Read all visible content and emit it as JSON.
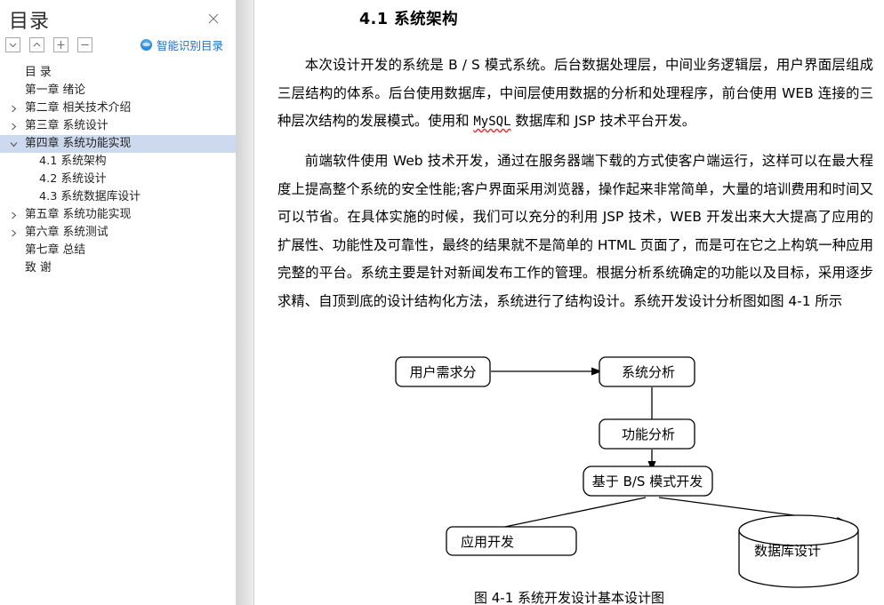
{
  "toc": {
    "title": "目录",
    "close_icon": "close-icon",
    "toolbar": [
      {
        "name": "collapse-all-button",
        "icon": "chevron-down-icon"
      },
      {
        "name": "expand-all-button",
        "icon": "chevron-up-icon"
      },
      {
        "name": "increase-level-button",
        "icon": "plus-icon"
      },
      {
        "name": "decrease-level-button",
        "icon": "minus-icon"
      }
    ],
    "smart_button": {
      "label": "智能识别目录",
      "icon": "smart-recognize-icon",
      "color": "#1f6fc4"
    },
    "selected_color": "#ccd9ef",
    "items": [
      {
        "label": "目  录",
        "level": 1,
        "arrow": "none",
        "selected": false
      },
      {
        "label": "第一章  绪论",
        "level": 1,
        "arrow": "none",
        "selected": false
      },
      {
        "label": "第二章  相关技术介绍",
        "level": 1,
        "arrow": "collapsed",
        "selected": false
      },
      {
        "label": "第三章  系统设计",
        "level": 1,
        "arrow": "collapsed",
        "selected": false
      },
      {
        "label": "第四章  系统功能实现",
        "level": 1,
        "arrow": "expanded",
        "selected": true
      },
      {
        "label": "4.1 系统架构",
        "level": 2,
        "arrow": "none",
        "selected": false
      },
      {
        "label": "4.2 系统设计",
        "level": 2,
        "arrow": "none",
        "selected": false
      },
      {
        "label": "4.3 系统数据库设计",
        "level": 2,
        "arrow": "none",
        "selected": false
      },
      {
        "label": "第五章  系统功能实现",
        "level": 1,
        "arrow": "collapsed",
        "selected": false
      },
      {
        "label": "第六章  系统测试",
        "level": 1,
        "arrow": "collapsed",
        "selected": false
      },
      {
        "label": "第七章  总结",
        "level": 1,
        "arrow": "none",
        "selected": false
      },
      {
        "label": "致  谢",
        "level": 1,
        "arrow": "none",
        "selected": false
      }
    ]
  },
  "document": {
    "heading": "4.1 系统架构",
    "paragraph1_a": "本次设计开发的系统是 B / S 模式系统。后台数据处理层，中间业务逻辑层，用户界面层组成三层结构的体系。后台使用数据库，中间层使用数据的分析和处理程序，前台使用 WEB 连接的三种层次结构的发展模式。使用和 ",
    "paragraph1_spell": "MySQL",
    "paragraph1_b": " 数据库和 JSP 技术平台开发。",
    "paragraph2": "前端软件使用 Web 技术开发，通过在服务器端下载的方式使客户端运行，这样可以在最大程度上提高整个系统的安全性能;客户界面采用浏览器，操作起来非常简单，大量的培训费用和时间又可以节省。在具体实施的时候，我们可以充分的利用 JSP 技术，WEB 开发出来大大提高了应用的扩展性、功能性及可靠性，最终的结果就不是简单的 HTML 页面了，而是可在它之上构筑一种应用完整的平台。系统主要是针对新闻发布工作的管理。根据分析系统确定的功能以及目标，采用逐步求精、自顶到底的设计结构化方法，系统进行了结构设计。系统开发设计分析图如图 4-1 所示",
    "figure": {
      "caption": "图 4-1 系统开发设计基本设计图",
      "nodes": [
        {
          "id": "n1",
          "label": "用户需求分",
          "shape": "rounded-rect"
        },
        {
          "id": "n2",
          "label": "系统分析",
          "shape": "rounded-rect"
        },
        {
          "id": "n3",
          "label": "功能分析",
          "shape": "rounded-rect"
        },
        {
          "id": "n4",
          "label": "基于 B/S 模式开发",
          "shape": "rounded-rect"
        },
        {
          "id": "n5",
          "label": "应用开发",
          "shape": "rounded-rect"
        },
        {
          "id": "n6",
          "label": "数据库设计",
          "shape": "cylinder"
        }
      ],
      "edges": [
        {
          "from": "n1",
          "to": "n2"
        },
        {
          "from": "n2",
          "to": "n3"
        },
        {
          "from": "n3",
          "to": "n4"
        },
        {
          "from": "n4",
          "to": "n5"
        },
        {
          "from": "n4",
          "to": "n6"
        }
      ]
    }
  }
}
